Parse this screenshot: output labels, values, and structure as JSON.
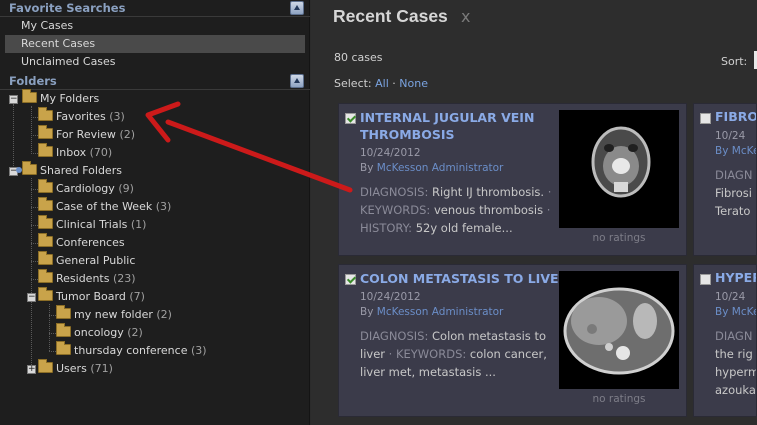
{
  "sidebar": {
    "favorites_header": "Favorite Searches",
    "favorites": [
      "My Cases",
      "Recent Cases",
      "Unclaimed Cases"
    ],
    "selected_favorite": "Recent Cases",
    "folders_header": "Folders",
    "my_folders": {
      "label": "My Folders",
      "children": [
        {
          "label": "Favorites",
          "count": "(3)"
        },
        {
          "label": "For Review",
          "count": "(2)"
        },
        {
          "label": "Inbox",
          "count": "(70)"
        }
      ]
    },
    "shared_folders": {
      "label": "Shared Folders",
      "children": [
        {
          "label": "Cardiology",
          "count": "(9)"
        },
        {
          "label": "Case of the Week",
          "count": "(3)"
        },
        {
          "label": "Clinical Trials",
          "count": "(1)"
        },
        {
          "label": "Conferences",
          "count": ""
        },
        {
          "label": "General Public",
          "count": ""
        },
        {
          "label": "Residents",
          "count": "(23)"
        },
        {
          "label": "Tumor Board",
          "count": "(7)"
        },
        {
          "label": "my new folder",
          "count": "(2)"
        },
        {
          "label": "oncology",
          "count": "(2)"
        },
        {
          "label": "thursday conference",
          "count": "(3)"
        },
        {
          "label": "Users",
          "count": "(71)"
        }
      ]
    }
  },
  "main": {
    "title": "Recent Cases",
    "close_glyph": "x",
    "case_count": "80 cases",
    "select_label": "Select:",
    "select_all": "All",
    "select_sep": "·",
    "select_none": "None",
    "sort_label": "Sort:",
    "cards": [
      {
        "checked": true,
        "title": "INTERNAL JUGULAR VEIN THROMBOSIS",
        "date": "10/24/2012",
        "by": "By",
        "author": "McKesson Administrator",
        "diagnosis_label": "DIAGNOSIS:",
        "diagnosis": "Right IJ thrombosis.",
        "keywords_label": "KEYWORDS:",
        "keywords": "venous thrombosis",
        "history_label": "HISTORY:",
        "history": "52y old female...",
        "rating": "no ratings",
        "thumb_icon": "ct-neck-scan-icon"
      },
      {
        "checked": true,
        "title": "COLON METASTASIS TO LIVER",
        "date": "10/24/2012",
        "by": "By",
        "author": "McKesson Administrator",
        "diagnosis_label": "DIAGNOSIS:",
        "diagnosis": "Colon metastasis to liver",
        "keywords_label": "KEYWORDS:",
        "keywords": "colon cancer, liver met, metastasis",
        "tail": "...",
        "rating": "no ratings",
        "thumb_icon": "ct-abdomen-scan-icon"
      }
    ],
    "partial_cards": [
      {
        "title": "FIBROS",
        "date": "10/24",
        "by": "By McKe",
        "line1": "DIAGN",
        "line2": "Fibrosi",
        "line3": "Terato"
      },
      {
        "title": "HYPER",
        "date": "10/24",
        "by": "By McKe",
        "line1": "DIAGN",
        "line2": "the rig",
        "line3": "hyperm",
        "line4": "azouka"
      }
    ]
  },
  "colors": {
    "annotation_arrow": "#cc1a1a",
    "link": "#7aa3e0",
    "card_bg": "#3b3b4a"
  }
}
